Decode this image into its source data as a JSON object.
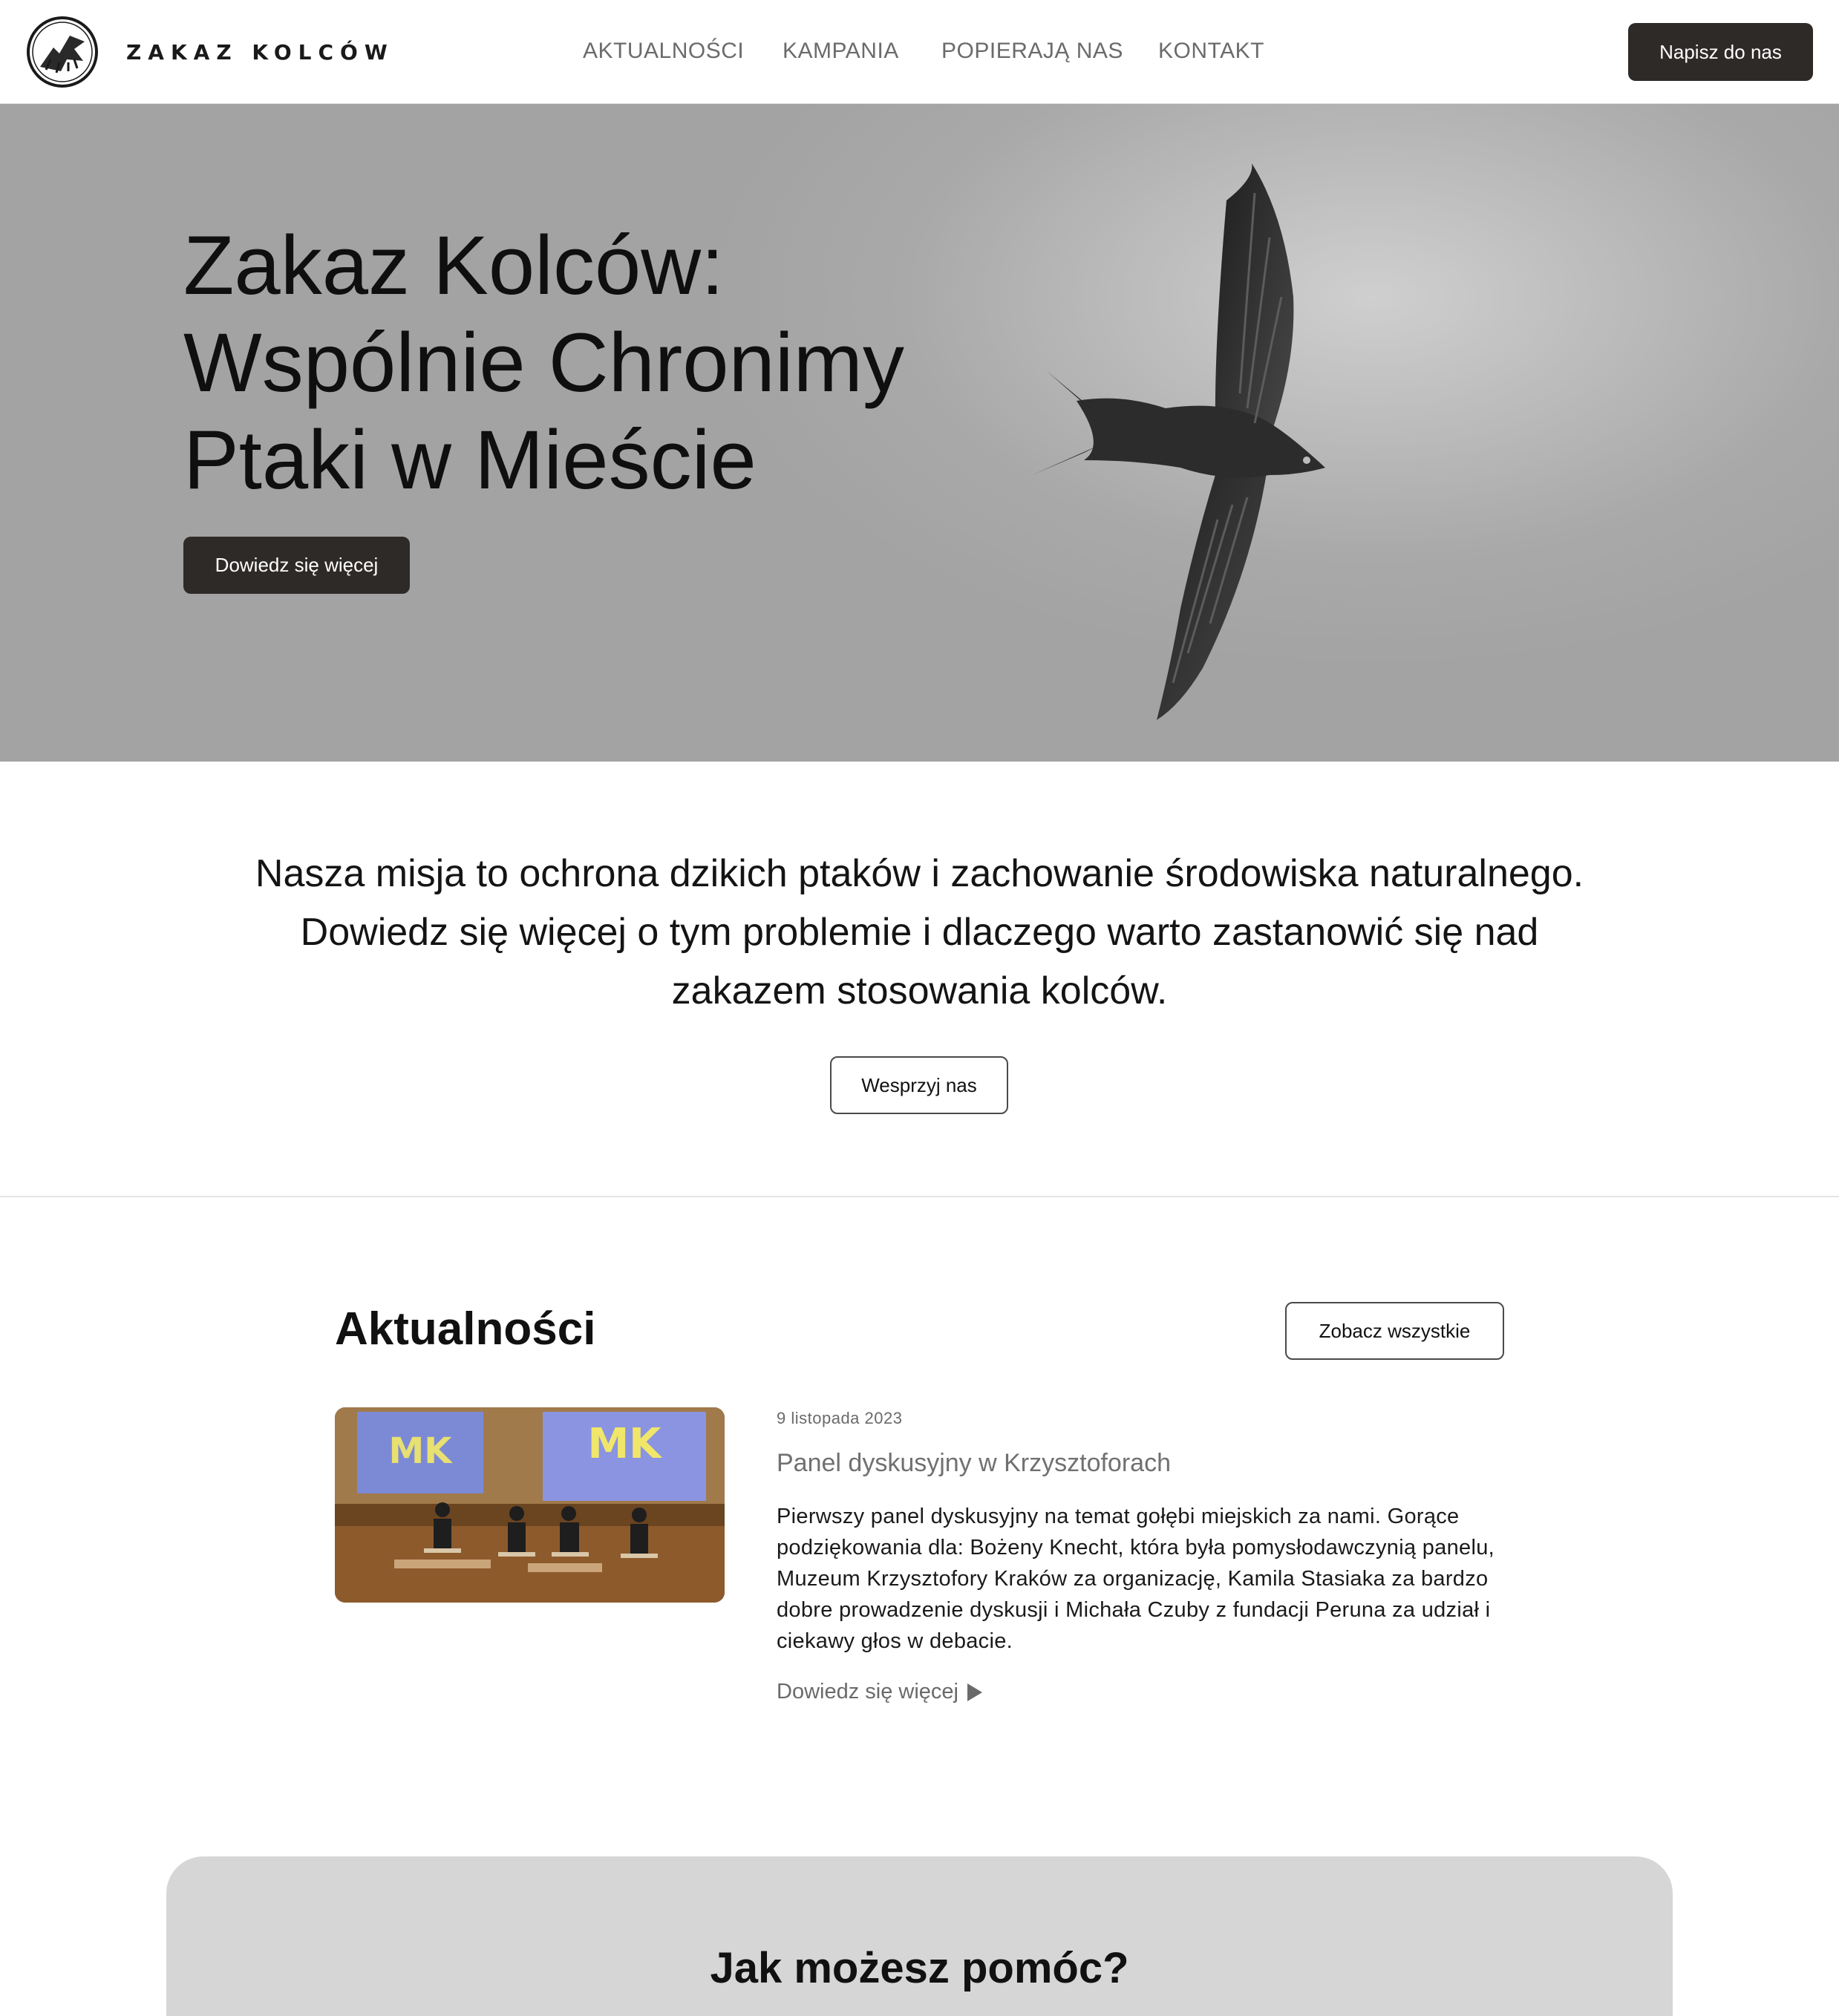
{
  "header": {
    "brand": "ZAKAZ KOLCÓW",
    "nav": [
      "AKTUALNOŚCI",
      "KAMPANIA",
      "POPIERAJĄ NAS",
      "KONTAKT"
    ],
    "cta": "Napisz do nas"
  },
  "hero": {
    "title_lines": [
      "Zakaz Kolców:",
      "Wspólnie Chronimy",
      "Ptaki w Mieście"
    ],
    "cta": "Dowiedz się więcej"
  },
  "mission": {
    "text": "Nasza misja to ochrona dzikich ptaków i zachowanie środowiska naturalnego. Dowiedz się więcej o tym problemie i dlaczego warto zastanowić się nad zakazem stosowania kolców.",
    "cta": "Wesprzyj nas"
  },
  "news": {
    "title": "Aktualności",
    "see_all": "Zobacz wszystkie",
    "items": [
      {
        "date": "9 listopada 2023",
        "headline": "Panel dyskusyjny w Krzysztoforach",
        "body": "Pierwszy panel dyskusyjny na temat gołębi miejskich za nami. Gorące podziękowania dla: Bożeny Knecht, która była pomysłodawczynią panelu, Muzeum Krzysztofory Kraków za organizację, Kamila Stasiaka za bardzo dobre prowadzenie dyskusji i Michała Czuby z fundacji Peruna za udział i ciekawy głos w debacie.",
        "more": "Dowiedz się więcej",
        "image_screen_text": "MK"
      }
    ]
  },
  "help": {
    "title": "Jak możesz pomóc?"
  },
  "colors": {
    "dark_button": "#2e2a28",
    "hero_bg": "#a6a6a6",
    "help_bg": "#d6d6d6"
  }
}
